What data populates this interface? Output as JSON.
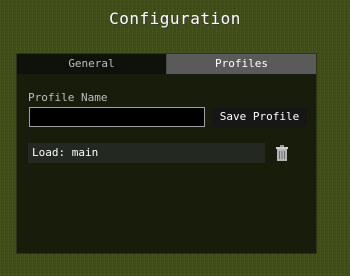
{
  "window": {
    "title": "Configuration"
  },
  "tabs": [
    {
      "label": "General",
      "active": false
    },
    {
      "label": "Profiles",
      "active": true
    }
  ],
  "profiles": {
    "name_label": "Profile Name",
    "name_value": "",
    "save_label": "Save Profile",
    "items": [
      {
        "label": "Load: main",
        "delete_icon": "trash-icon"
      }
    ]
  },
  "colors": {
    "background": "#404e18",
    "panel": "#171c0b",
    "active_tab": "#5a5a5a",
    "text": "#ffffff",
    "label": "#bfbfbf"
  }
}
